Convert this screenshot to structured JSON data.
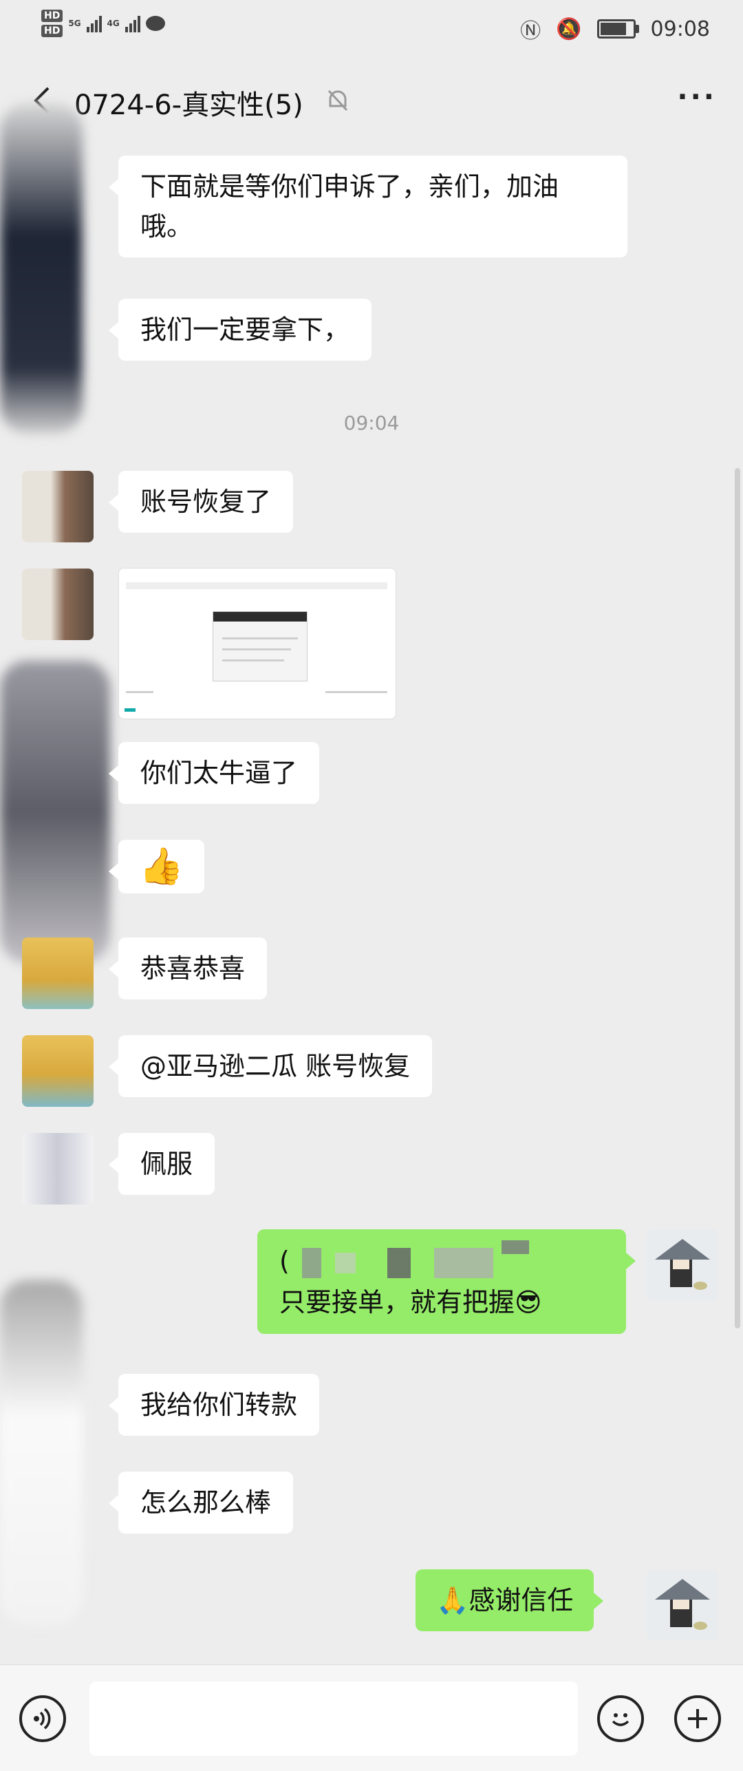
{
  "status_bar": {
    "hd1": "HD",
    "hd2": "HD",
    "net1": "5G",
    "net2": "4G",
    "time": "09:08"
  },
  "header": {
    "back_glyph": "‹",
    "title": "0724-6-真实性(5)",
    "more_glyph": "···"
  },
  "messages": {
    "m1": "下面就是等你们申诉了，亲们，加油哦。",
    "m2": "我们一定要拿下，",
    "timestamp": "09:04",
    "m3": "账号恢复了",
    "m5": "你们太牛逼了",
    "m6": "👍",
    "m7": "恭喜恭喜",
    "m8": "@亚马逊二瓜  账号恢复",
    "m9": "佩服",
    "m10_line1": "(",
    "m10_line2": "只要接单，就有把握😎",
    "m11": "我给你们转款",
    "m12": "怎么那么棒",
    "m13": "🙏感谢信任"
  },
  "colors": {
    "background": "#ededed",
    "incoming_bubble": "#ffffff",
    "outgoing_bubble": "#95ec69"
  },
  "icons": {
    "back": "chevron-left-icon",
    "mute": "bell-off-icon",
    "more": "more-horizontal-icon",
    "voice": "voice-icon",
    "emoji": "smiley-icon",
    "plus": "plus-icon"
  },
  "battery_level": 0.9
}
